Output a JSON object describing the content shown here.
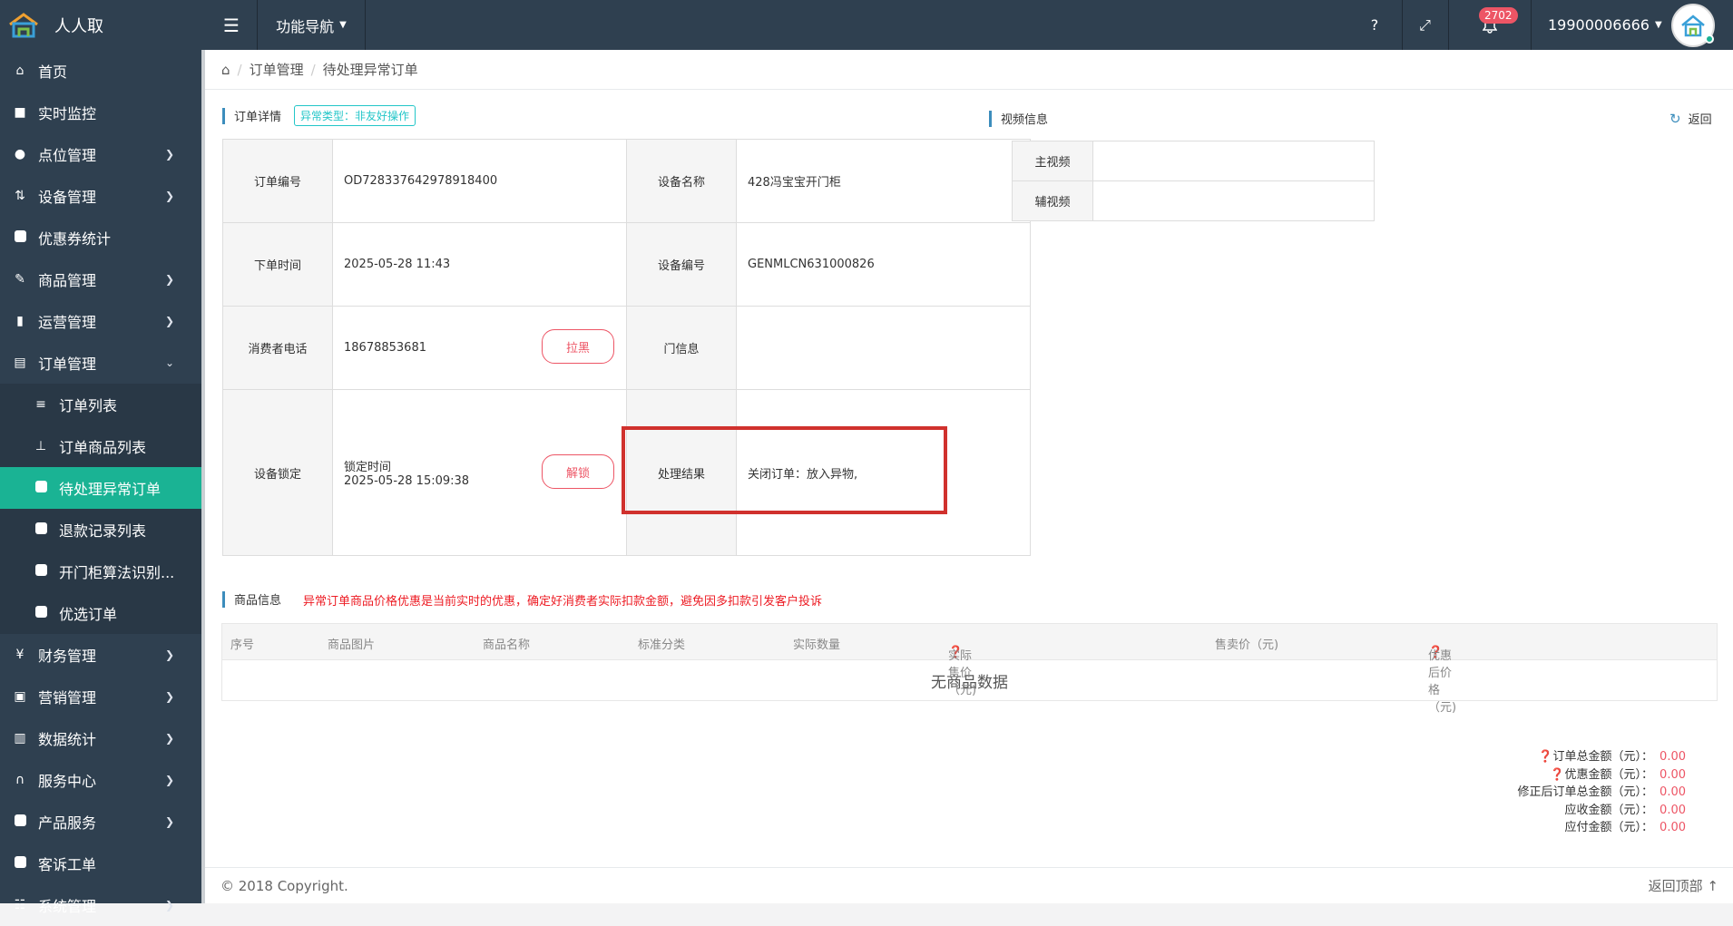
{
  "brand": {
    "name": "人人取"
  },
  "topbar": {
    "func_nav": "功能导航",
    "help": "?",
    "notif_count": "2702",
    "user": "19900006666"
  },
  "sidebar": {
    "items": [
      {
        "label": "首页"
      },
      {
        "label": "实时监控"
      },
      {
        "label": "点位管理"
      },
      {
        "label": "设备管理"
      },
      {
        "label": "优惠券统计"
      },
      {
        "label": "商品管理"
      },
      {
        "label": "运营管理"
      },
      {
        "label": "订单管理"
      },
      {
        "label": "订单列表"
      },
      {
        "label": "订单商品列表"
      },
      {
        "label": "待处理异常订单"
      },
      {
        "label": "退款记录列表"
      },
      {
        "label": "开门柜算法识别..."
      },
      {
        "label": "优选订单"
      },
      {
        "label": "财务管理"
      },
      {
        "label": "营销管理"
      },
      {
        "label": "数据统计"
      },
      {
        "label": "服务中心"
      },
      {
        "label": "产品服务"
      },
      {
        "label": "客诉工单"
      },
      {
        "label": "系统管理"
      }
    ]
  },
  "breadcrumb": {
    "level1": "订单管理",
    "level2": "待处理异常订单"
  },
  "order": {
    "title": "订单详情",
    "tag": "异常类型：非友好操作",
    "order_no_label": "订单编号",
    "order_no": "OD728337642978918400",
    "device_name_label": "设备名称",
    "device_name": "428冯宝宝开门柜",
    "time_label": "下单时间",
    "time": "2025-05-28 11:43",
    "device_no_label": "设备编号",
    "device_no": "GENMLCN631000826",
    "phone_label": "消费者电话",
    "phone": "18678853681",
    "blacklist_btn": "拉黑",
    "door_label": "门信息",
    "lock_label": "设备锁定",
    "lock_time_label": "锁定时间",
    "lock_time": "2025-05-28 15:09:38",
    "unlock_btn": "解锁",
    "result_label": "处理结果",
    "result": "关闭订单：放入异物,"
  },
  "video": {
    "title": "视频信息",
    "main_label": "主视频",
    "aux_label": "辅视频",
    "back": "返回"
  },
  "products": {
    "title": "商品信息",
    "warning": "异常订单商品价格优惠是当前实时的优惠，确定好消费者实际扣款金额，避免因多扣款引发客户投诉",
    "columns": [
      "序号",
      "商品图片",
      "商品名称",
      "标准分类",
      "实际数量",
      "实际售价（元)",
      "售卖价（元)",
      "优惠后价格（元)"
    ],
    "empty": "无商品数据"
  },
  "summary": {
    "total_label": "订单总金额（元）：",
    "total": "0.00",
    "discount_label": "优惠金额（元）：",
    "discount": "0.00",
    "corrected_label": "修正后订单总金额（元）：",
    "corrected": "0.00",
    "receivable_label": "应收金额（元）：",
    "receivable": "0.00",
    "payable_label": "应付金额（元）：",
    "payable": "0.00"
  },
  "footer": {
    "copyright": "© 2018 Copyright.",
    "back_top": "返回顶部"
  }
}
